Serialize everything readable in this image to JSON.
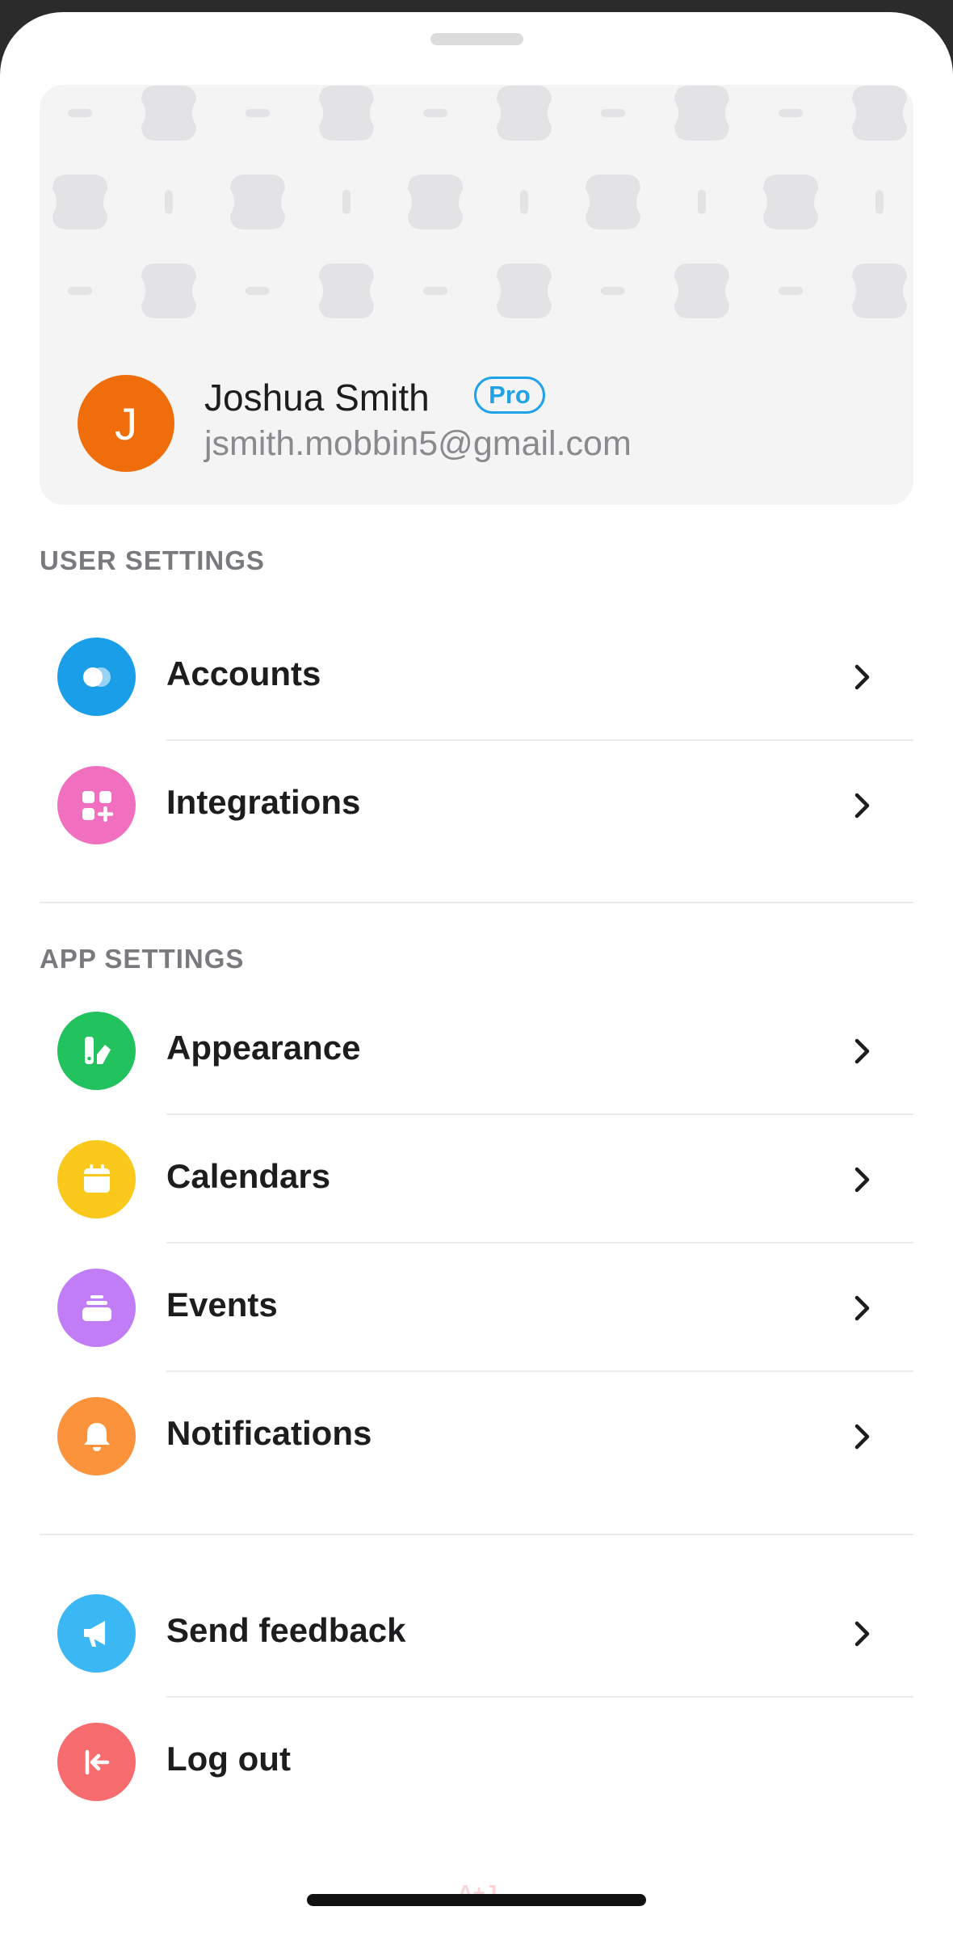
{
  "profile": {
    "avatar_initial": "J",
    "name": "Joshua Smith",
    "badge": "Pro",
    "email": "jsmith.mobbin5@gmail.com"
  },
  "user_settings": {
    "title": "USER SETTINGS",
    "items": [
      {
        "label": "Accounts",
        "icon": "accounts-icon",
        "color": "#1a9ee8"
      },
      {
        "label": "Integrations",
        "icon": "integrations-icon",
        "color": "#f06fbf"
      }
    ]
  },
  "app_settings": {
    "title": "APP SETTINGS",
    "items": [
      {
        "label": "Appearance",
        "icon": "appearance-icon",
        "color": "#22c25e"
      },
      {
        "label": "Calendars",
        "icon": "calendar-icon",
        "color": "#fbc91c"
      },
      {
        "label": "Events",
        "icon": "events-icon",
        "color": "#c17df6"
      },
      {
        "label": "Notifications",
        "icon": "bell-icon",
        "color": "#fb923c"
      }
    ]
  },
  "other": {
    "items": [
      {
        "label": "Send feedback",
        "icon": "megaphone-icon",
        "color": "#3bb8f4"
      },
      {
        "label": "Log out",
        "icon": "logout-icon",
        "color": "#f76c6e"
      }
    ]
  },
  "watermark": "A+J"
}
